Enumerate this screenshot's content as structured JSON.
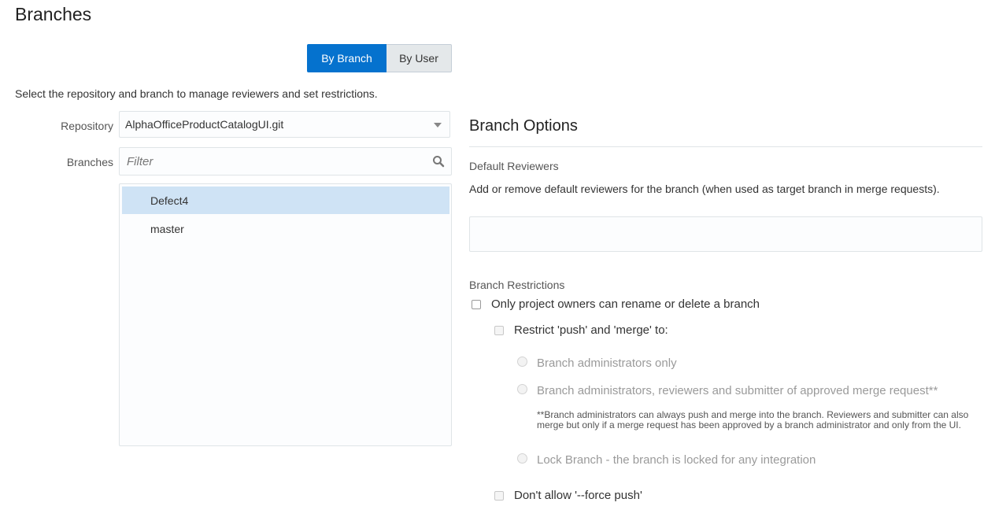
{
  "page": {
    "title": "Branches",
    "instructions": "Select the repository and branch to manage reviewers and set restrictions."
  },
  "view_toggle": {
    "by_branch": "By Branch",
    "by_user": "By User",
    "active": "By Branch"
  },
  "repository": {
    "label": "Repository",
    "value": "AlphaOfficeProductCatalogUI.git"
  },
  "branches": {
    "label": "Branches",
    "filter_placeholder": "Filter",
    "items": [
      {
        "name": "Defect4",
        "selected": true
      },
      {
        "name": "master",
        "selected": false
      }
    ]
  },
  "branch_options": {
    "title": "Branch Options",
    "default_reviewers": {
      "label": "Default Reviewers",
      "description": "Add or remove default reviewers for the branch (when used as target branch in merge requests)."
    },
    "restrictions": {
      "label": "Branch Restrictions",
      "owners_only": "Only project owners can rename or delete a branch",
      "restrict_push_merge": "Restrict 'push' and 'merge' to:",
      "radio_admins_only": "Branch administrators only",
      "radio_admins_reviewers": "Branch administrators, reviewers and submitter of approved merge request**",
      "footnote": "**Branch administrators can always push and merge into the branch. Reviewers and submitter can also merge but only if a merge request has been approved by a branch administrator and only from the UI.",
      "radio_lock": "Lock Branch - the branch is locked for any integration",
      "no_force_push": "Don't allow '--force push'"
    }
  },
  "colors": {
    "accent": "#0572ce",
    "selected_row": "#cfe3f5"
  }
}
